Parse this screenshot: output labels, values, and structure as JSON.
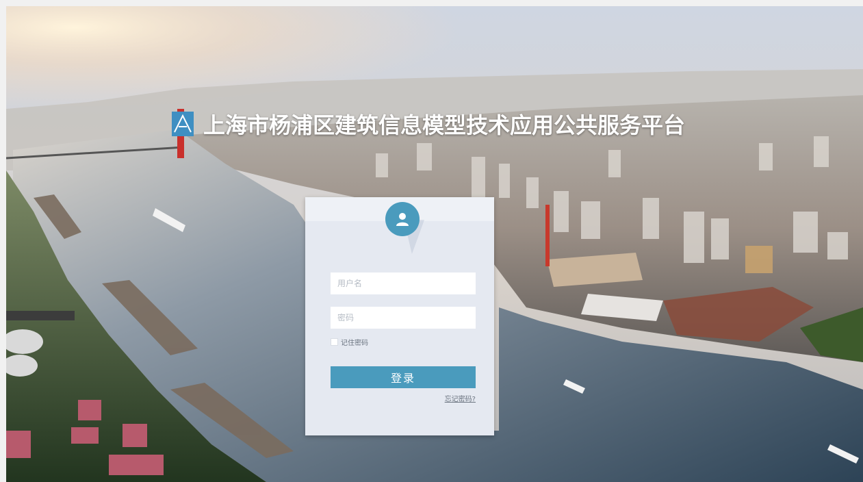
{
  "header": {
    "title": "上海市杨浦区建筑信息模型技术应用公共服务平台"
  },
  "login": {
    "username_placeholder": "用户名",
    "password_placeholder": "密码",
    "remember_label": "记住密码",
    "submit_label": "登录",
    "forgot_label": "忘记密码?"
  },
  "colors": {
    "accent": "#4a9bbd",
    "card_bg": "#e5e9f1",
    "logo_blue": "#3f8fc2"
  },
  "icons": {
    "avatar": "user-icon",
    "logo": "platform-logo"
  }
}
